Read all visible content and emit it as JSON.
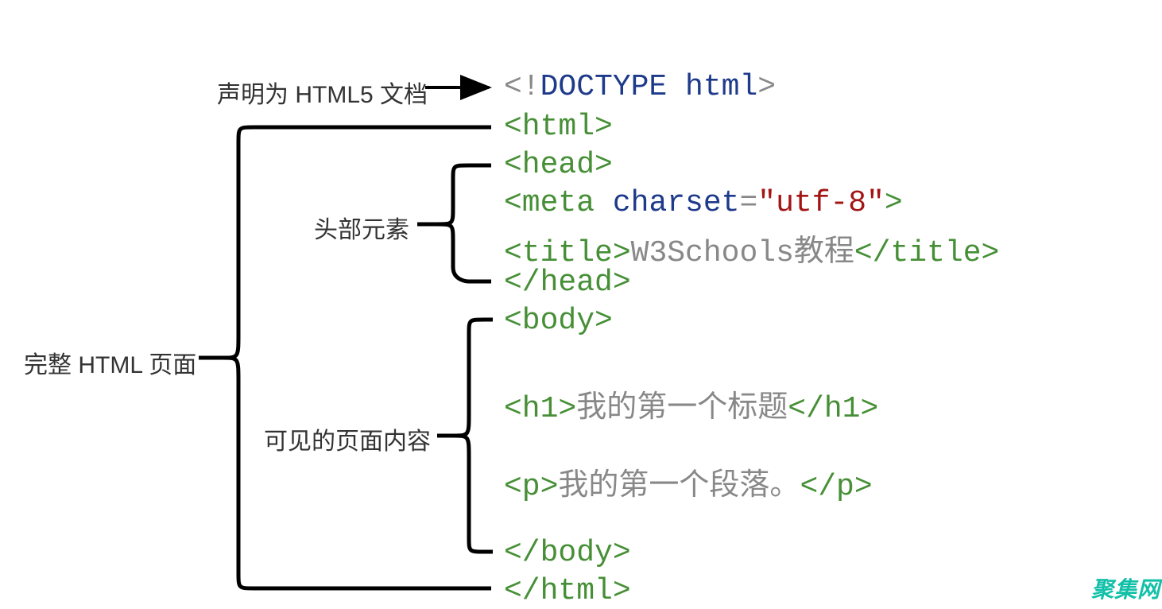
{
  "labels": {
    "doctype": "声明为 HTML5 文档",
    "fullpage": "完整 HTML 页面",
    "head": "头部元素",
    "body": "可见的页面内容"
  },
  "code": {
    "doctype_open": "<!",
    "doctype_word": "DOCTYPE html",
    "doctype_close": ">",
    "html_open": "<html>",
    "head_open": "<head>",
    "meta_open": "<meta",
    "meta_attr": " charset",
    "meta_eq": "=",
    "meta_val": "\"utf-8\"",
    "meta_close": ">",
    "title_open": "<title>",
    "title_text": "W3Schools教程",
    "title_close": "</title>",
    "head_close": "</head>",
    "body_open": "<body>",
    "h1_open": "<h1>",
    "h1_text": "我的第一个标题",
    "h1_close": "</h1>",
    "p_open": "<p>",
    "p_text": "我的第一个段落。",
    "p_close": "</p>",
    "body_close": "</body>",
    "html_close": "</html>"
  },
  "watermark": "聚集网"
}
